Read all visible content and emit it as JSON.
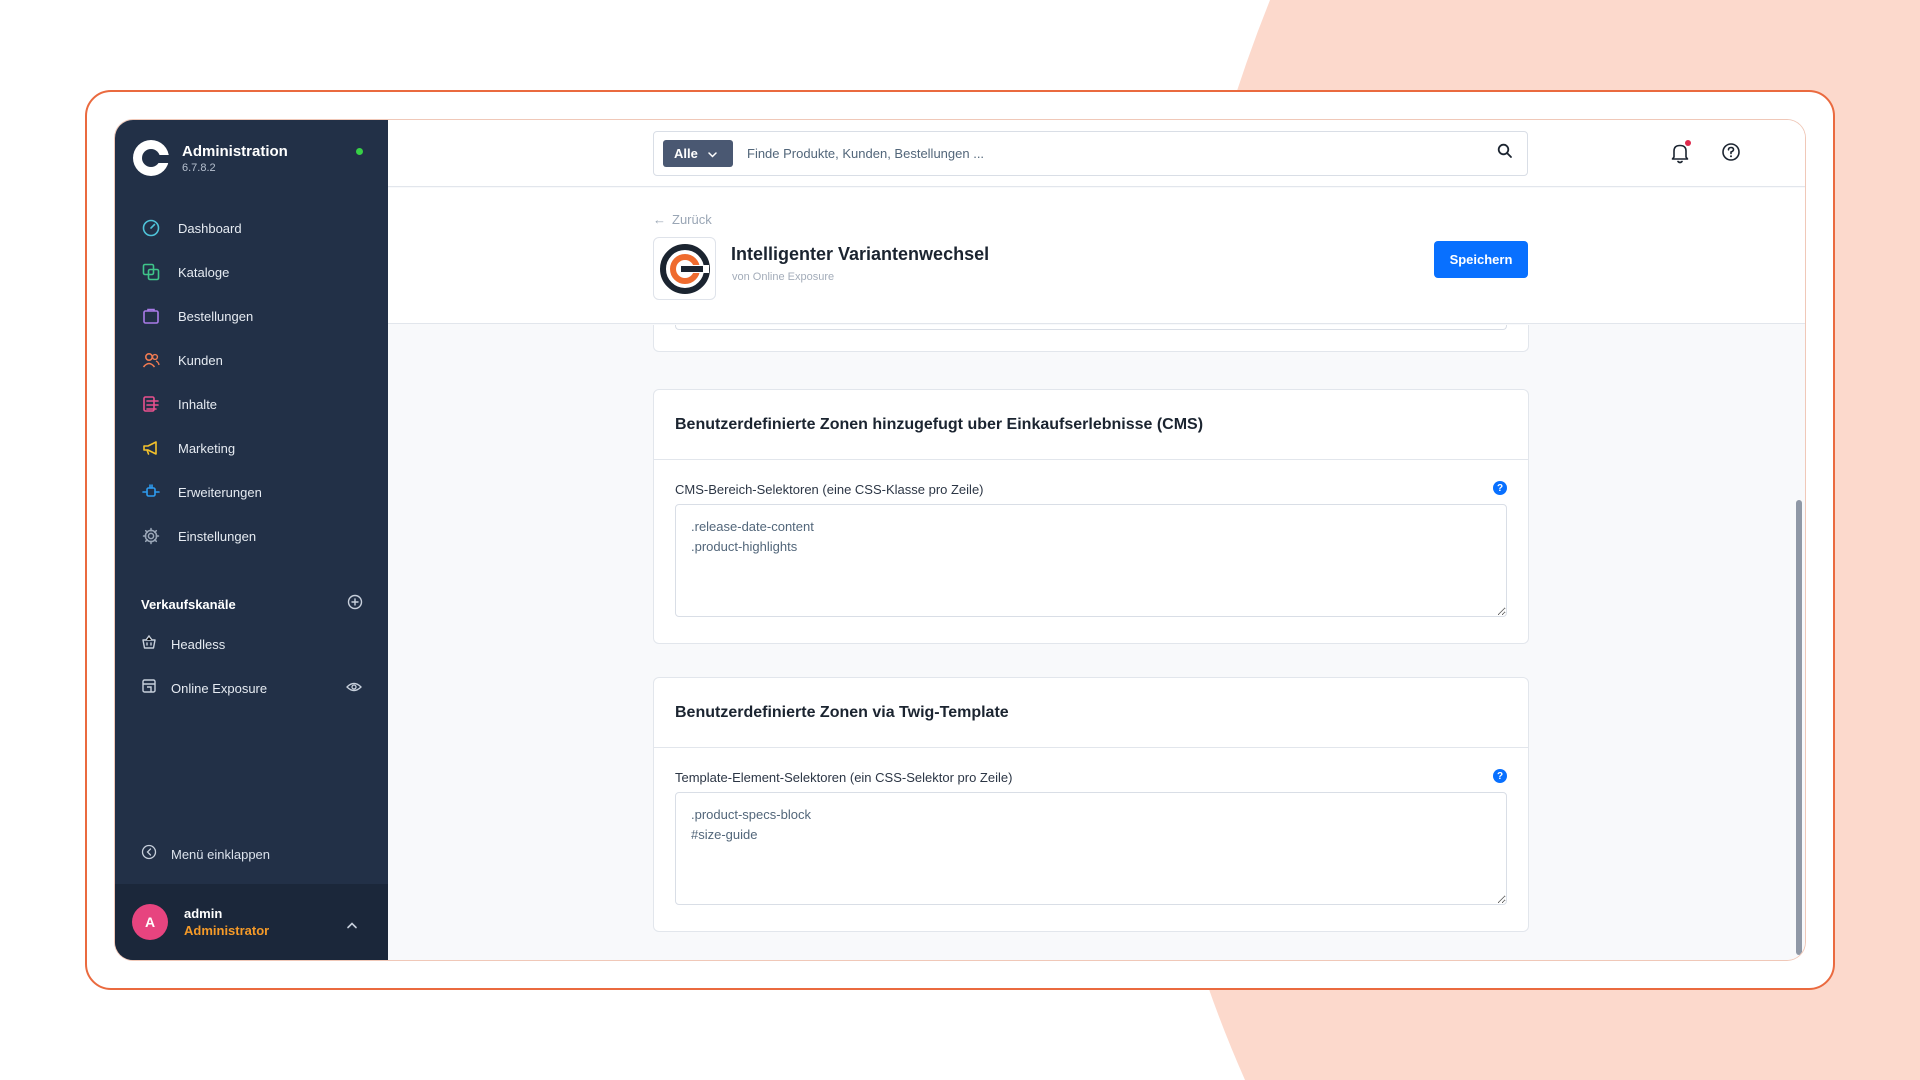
{
  "colors": {
    "accent": "#0870ff",
    "sidebar": "#223047",
    "frame": "#ea6a3f",
    "bg_shape": "#fcd9cc",
    "online": "#37d046",
    "role": "#f59a28",
    "avatar": "#e7447f"
  },
  "sidebar": {
    "brand_title": "Administration",
    "version": "6.7.8.2",
    "items": [
      {
        "label": "Dashboard",
        "icon": "dashboard-icon"
      },
      {
        "label": "Kataloge",
        "icon": "catalog-icon"
      },
      {
        "label": "Bestellungen",
        "icon": "orders-icon"
      },
      {
        "label": "Kunden",
        "icon": "customers-icon"
      },
      {
        "label": "Inhalte",
        "icon": "content-icon"
      },
      {
        "label": "Marketing",
        "icon": "megaphone-icon"
      },
      {
        "label": "Erweiterungen",
        "icon": "plug-icon"
      },
      {
        "label": "Einstellungen",
        "icon": "gear-icon"
      }
    ],
    "sales_channels_title": "Verkaufskanäle",
    "channels": [
      {
        "label": "Headless",
        "icon": "basket-icon"
      },
      {
        "label": "Online Exposure",
        "icon": "storefront-icon"
      }
    ],
    "collapse_label": "Menü einklappen",
    "user": {
      "initial": "A",
      "name": "admin",
      "role": "Administrator"
    }
  },
  "topbar": {
    "search_type": "Alle",
    "search_placeholder": "Finde Produkte, Kunden, Bestellungen ..."
  },
  "header": {
    "back_label": "Zurück",
    "plugin_title": "Intelligenter Variantenwechsel",
    "vendor": "von Online Exposure",
    "save_label": "Speichern"
  },
  "cards": [
    {
      "title": "Benutzerdefinierte Zonen hinzugefugt uber Einkaufserlebnisse (CMS)",
      "field_label": "CMS-Bereich-Selektoren (eine CSS-Klasse pro Zeile)",
      "value": ".release-date-content\n.product-highlights"
    },
    {
      "title": "Benutzerdefinierte Zonen via Twig-Template",
      "field_label": "Template-Element-Selektoren (ein CSS-Selektor pro Zeile)",
      "value": ".product-specs-block\n#size-guide"
    }
  ]
}
